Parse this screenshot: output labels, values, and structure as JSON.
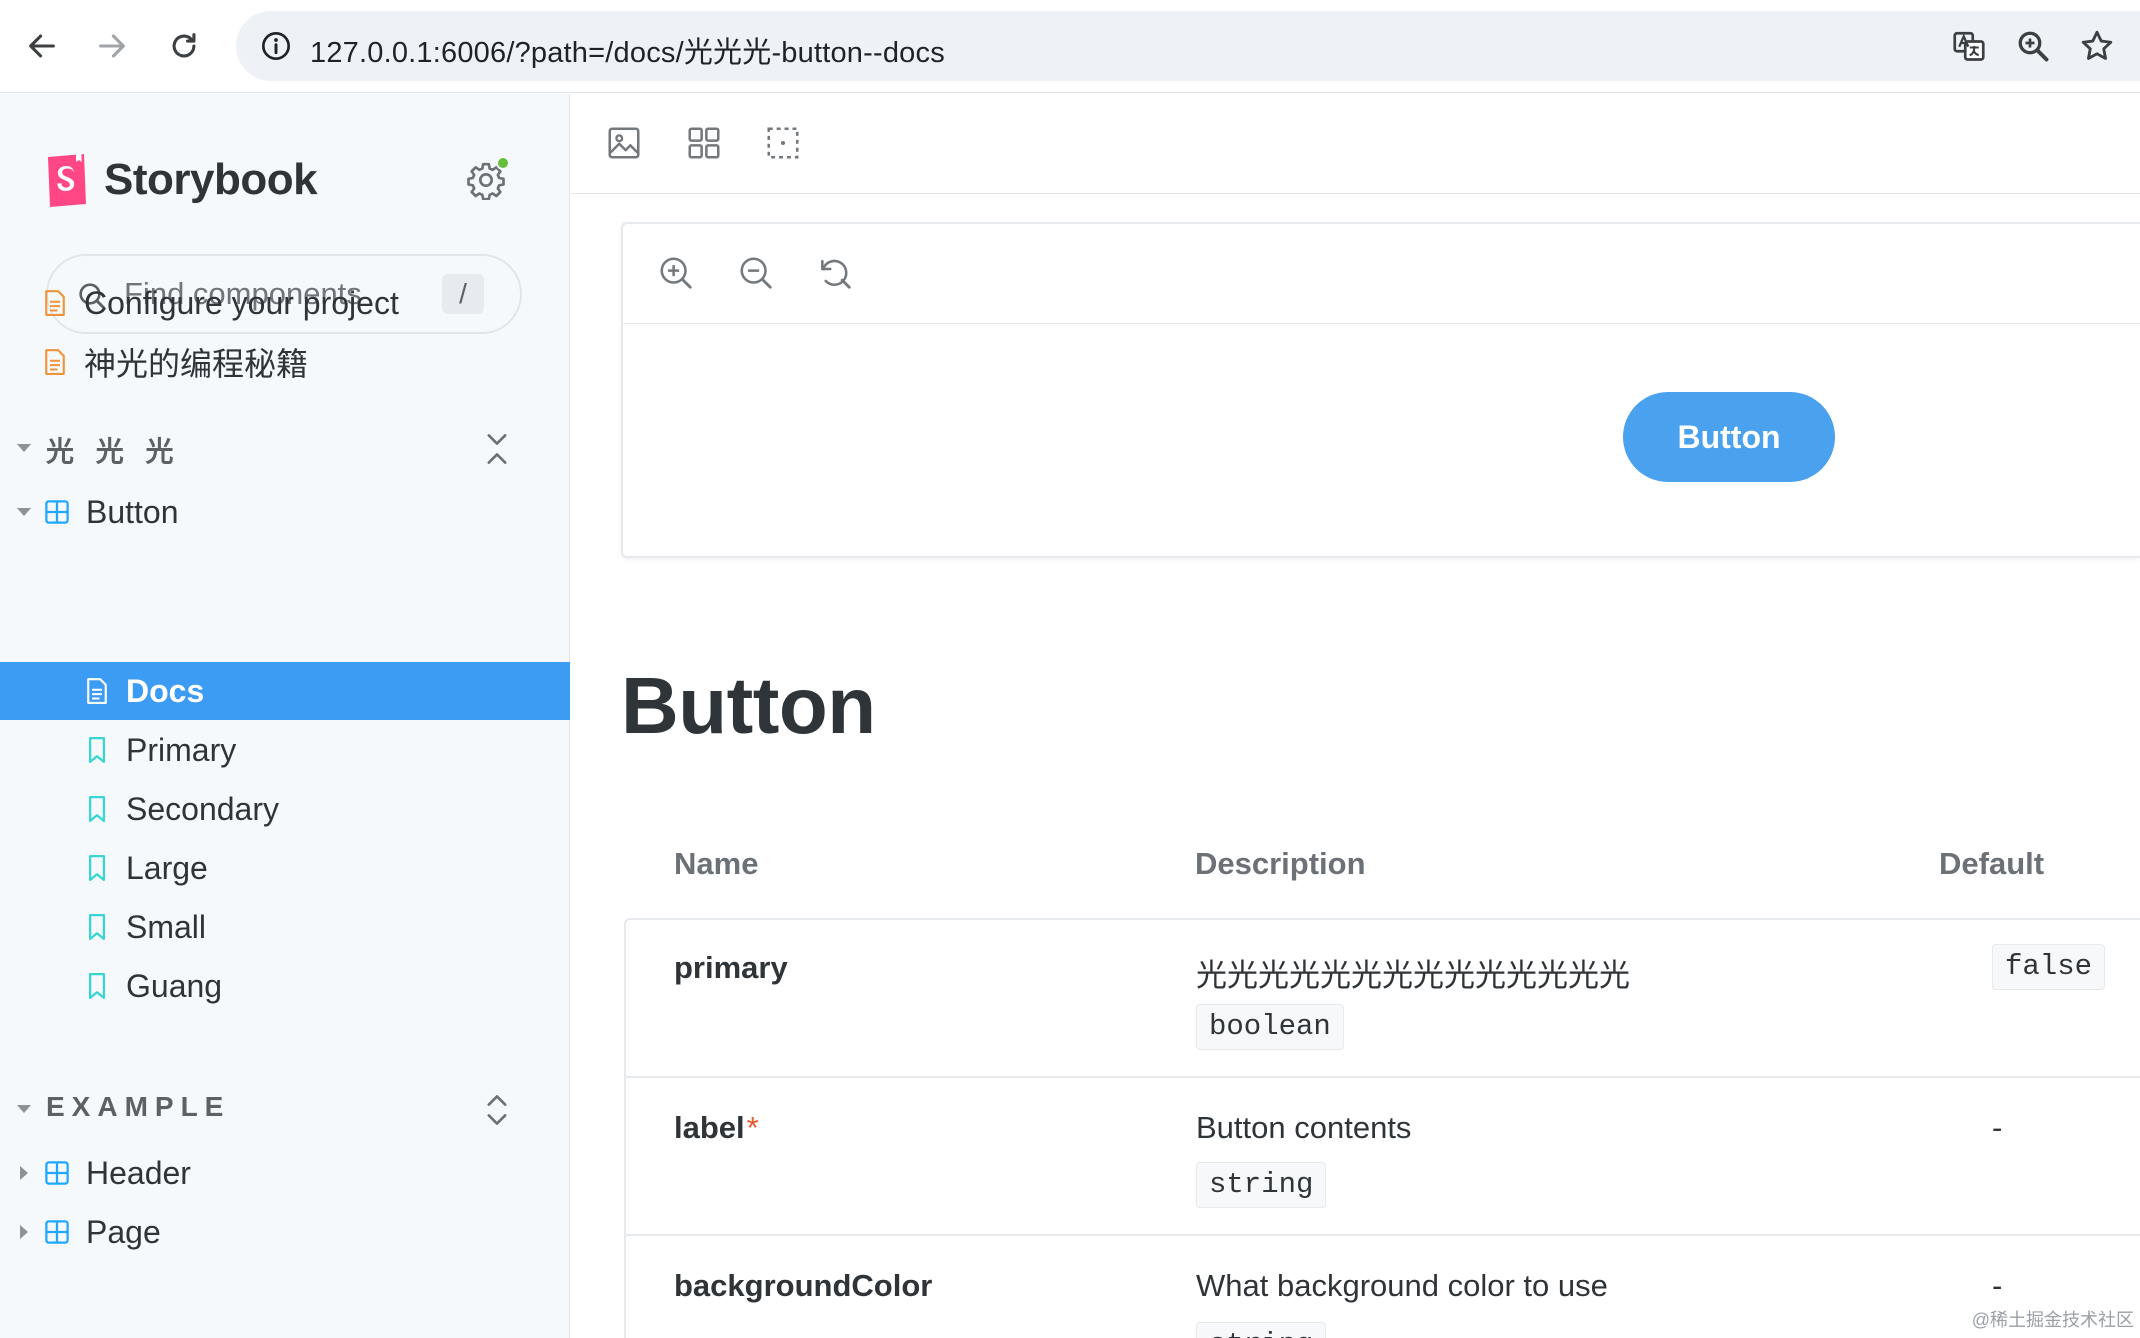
{
  "browser": {
    "url": "127.0.0.1:6006/?path=/docs/光光光-button--docs"
  },
  "sidebar": {
    "brand": "Storybook",
    "search": {
      "placeholder": "Find components",
      "shortcut": "/"
    },
    "top_items": [
      {
        "label": "Configure your project",
        "icon": "document-icon"
      },
      {
        "label": "神光的编程秘籍",
        "icon": "document-icon"
      }
    ],
    "groups": [
      {
        "label": "光 光 光",
        "component": "Button",
        "stories": [
          {
            "label": "Docs",
            "icon": "document-icon",
            "selected": true
          },
          {
            "label": "Primary",
            "icon": "bookmark-icon"
          },
          {
            "label": "Secondary",
            "icon": "bookmark-icon"
          },
          {
            "label": "Large",
            "icon": "bookmark-icon"
          },
          {
            "label": "Small",
            "icon": "bookmark-icon"
          },
          {
            "label": "Guang",
            "icon": "bookmark-icon"
          }
        ]
      },
      {
        "label": "EXAMPLE",
        "components": [
          "Header",
          "Page"
        ]
      }
    ],
    "colors": {
      "selected": "#3c9cf3",
      "status_dot": "#66bf3c",
      "doc_icon": "#f0943a",
      "story_icon": "#37d5d3",
      "component_icon": "#1ea7fd"
    }
  },
  "main": {
    "preview_button": "Button",
    "title": "Button",
    "table": {
      "headers": [
        "Name",
        "Description",
        "Default"
      ],
      "rows": [
        {
          "name": "primary",
          "required": "",
          "description": "光光光光光光光光光光光光光光",
          "type": "boolean",
          "default": "false"
        },
        {
          "name": "label",
          "required": "*",
          "description": "Button contents",
          "type": "string",
          "default": "-"
        },
        {
          "name": "backgroundColor",
          "required": "",
          "description": "What background color to use",
          "type": "string",
          "default": "-"
        }
      ]
    },
    "colors": {
      "button": "#4aa1ee"
    }
  },
  "watermark": "@稀土掘金技术社区"
}
